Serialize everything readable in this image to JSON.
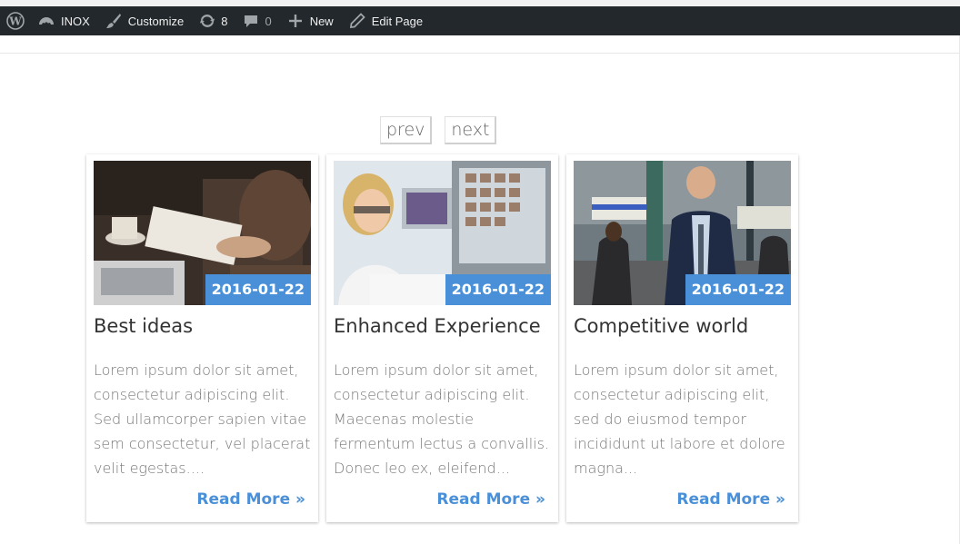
{
  "admin_bar": {
    "site_name": "INOX",
    "customize": "Customize",
    "updates_count": "8",
    "comments_count": "0",
    "new_label": "New",
    "edit_label": "Edit Page"
  },
  "pager": {
    "prev": "prev",
    "next": "next"
  },
  "colors": {
    "accent": "#4a90d9",
    "admin_bg": "#23282d"
  },
  "posts": [
    {
      "date": "2016-01-22",
      "title": "Best ideas",
      "excerpt": [
        "Lorem ipsum dolor sit amet,",
        "consectetur adipiscing elit.",
        "Sed ullamcorper sapien vitae",
        "sem consectetur, vel placerat",
        "velit egestas...."
      ],
      "read_more": "Read More »"
    },
    {
      "date": "2016-01-22",
      "title": "Enhanced Experience",
      "excerpt": [
        "Lorem ipsum dolor sit amet,",
        "consectetur adipiscing elit.",
        "Maecenas molestie",
        "fermentum lectus a convallis.",
        "Donec leo ex, eleifend..."
      ],
      "read_more": "Read More »"
    },
    {
      "date": "2016-01-22",
      "title": "Competitive world",
      "excerpt": [
        "Lorem ipsum dolor sit amet,",
        "consectetur adipiscing elit,",
        "sed do eiusmod tempor",
        "incididunt ut labore et dolore",
        "magna..."
      ],
      "read_more": "Read More »"
    }
  ]
}
